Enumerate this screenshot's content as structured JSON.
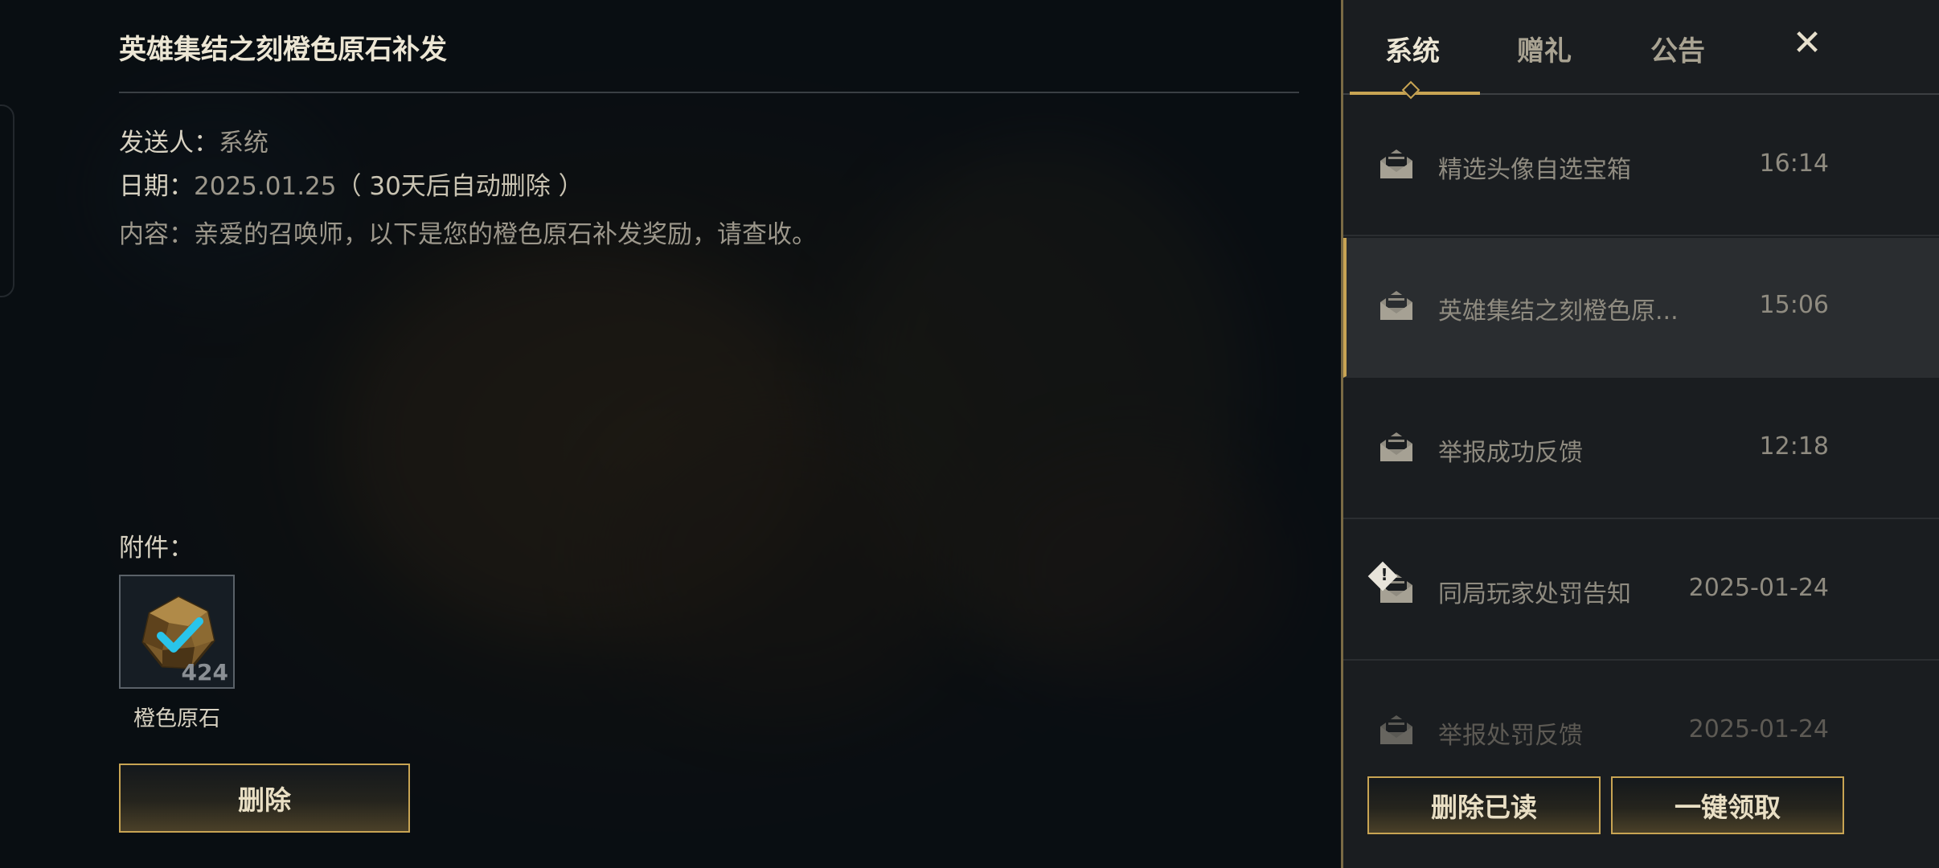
{
  "detail": {
    "title": "英雄集结之刻橙色原石补发",
    "sender_label": "发送人：",
    "sender_value": "系统",
    "date_label": "日期：",
    "date_value": "2025.01.25",
    "date_note": "（ 30天后自动删除 ）",
    "content_label": "内容：",
    "content_value": "亲爱的召唤师，以下是您的橙色原石补发奖励，请查收。",
    "attachment_label": "附件：",
    "attachment": {
      "name": "橙色原石",
      "count": "424",
      "icon": "orange-essence-icon"
    },
    "delete_label": "删除"
  },
  "panel": {
    "tabs": [
      "系统",
      "赠礼",
      "公告"
    ],
    "active_tab": "系统",
    "close_symbol": "✕",
    "mails": [
      {
        "subject": "精选头像自选宝箱",
        "time": "16:14",
        "icon": "mail-opened-icon",
        "warning": false
      },
      {
        "subject": "英雄集结之刻橙色原...",
        "time": "15:06",
        "icon": "mail-opened-icon",
        "warning": false
      },
      {
        "subject": "举报成功反馈",
        "time": "12:18",
        "icon": "mail-opened-icon",
        "warning": false
      },
      {
        "subject": "同局玩家处罚告知",
        "time": "2025-01-24",
        "icon": "mail-opened-icon",
        "warning": true,
        "warning_symbol": "!"
      },
      {
        "subject": "举报处罚反馈",
        "time": "2025-01-24",
        "icon": "mail-opened-icon",
        "warning": false
      }
    ],
    "delete_read_label": "删除已读",
    "claim_all_label": "一键领取"
  },
  "colors": {
    "gold_accent": "#c8a453",
    "panel_bg": "#1a1d20",
    "selected_row_bg": "#2a2d30"
  }
}
